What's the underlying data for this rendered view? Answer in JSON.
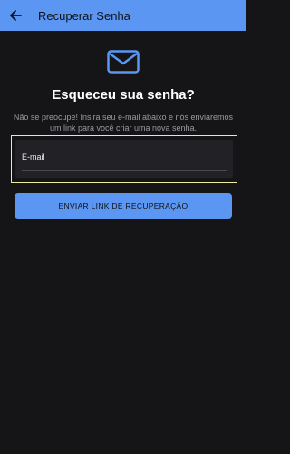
{
  "app_bar": {
    "back_icon": "arrow-left-icon",
    "title": "Recuperar Senha"
  },
  "hero": {
    "icon": "mail-icon"
  },
  "main": {
    "heading": "Esqueceu sua senha?",
    "description": "Não se preocupe! Insira seu e-mail abaixo e nós enviaremos um link para você criar uma nova senha.",
    "email_label": "E-mail",
    "email_value": "",
    "submit_label": "ENVIAR LINK DE RECUPERAÇÃO"
  },
  "colors": {
    "accent": "#5b97f2",
    "background": "#151517",
    "focus_border": "#ecec9a",
    "field_background": "#222226",
    "muted_text": "#9a9aa0"
  }
}
